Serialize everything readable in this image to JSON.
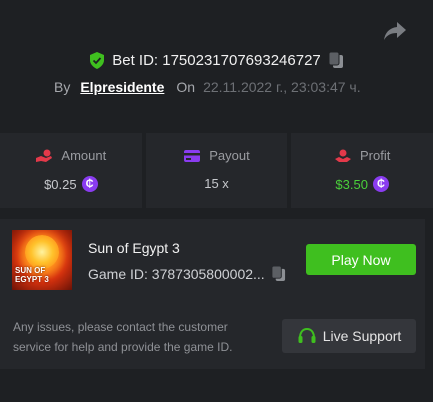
{
  "header": {
    "share_icon": "share-arrow-icon",
    "bet_id_label": "Bet ID: 1750231707693246727",
    "by_label": "By",
    "username": "Elpresidente",
    "on_label": "On",
    "date": "22.11.2022 г., 23:03:47 ч."
  },
  "stats": [
    {
      "label": "Amount",
      "value": "$0.25",
      "icon": "hand-coin-icon",
      "coin": "₵",
      "color": "#e3394a"
    },
    {
      "label": "Payout",
      "value": "15 x",
      "icon": "card-icon",
      "color": "#8a3cf0"
    },
    {
      "label": "Profit",
      "value": "$3.50",
      "icon": "profit-hand-icon",
      "coin": "₵",
      "color": "#e3394a"
    }
  ],
  "game": {
    "title": "Sun of Egypt 3",
    "game_id": "Game ID: 3787305800002...",
    "thumb_text": "SUN OF EGYPT 3",
    "play_label": "Play Now"
  },
  "support": {
    "text": "Any issues, please contact the customer service for help and provide the game ID.",
    "button_label": "Live Support"
  },
  "colors": {
    "accent_green": "#3fbf1f",
    "profit_green": "#4ad03a",
    "coin_purple": "#8a3cf0",
    "shield_green": "#3fbf1f"
  }
}
